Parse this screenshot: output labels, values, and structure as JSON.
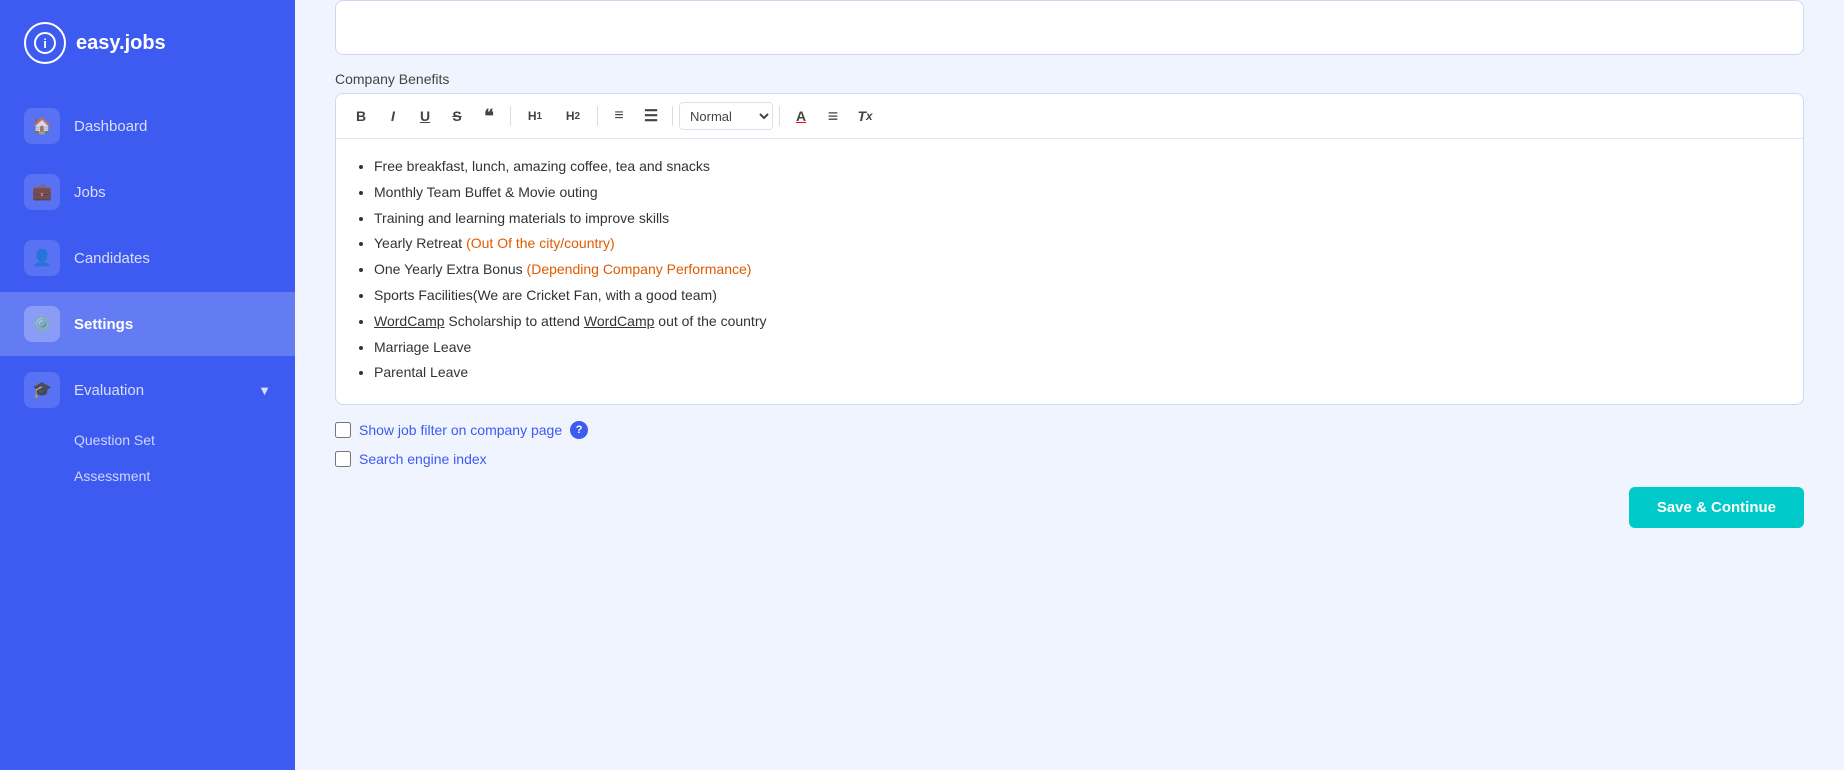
{
  "app": {
    "logo_text": "easy.jobs",
    "logo_icon": "i"
  },
  "sidebar": {
    "items": [
      {
        "id": "dashboard",
        "label": "Dashboard",
        "icon": "🏠"
      },
      {
        "id": "jobs",
        "label": "Jobs",
        "icon": "💼"
      },
      {
        "id": "candidates",
        "label": "Candidates",
        "icon": "👤"
      },
      {
        "id": "settings",
        "label": "Settings",
        "icon": "⚙️",
        "active": true
      },
      {
        "id": "evaluation",
        "label": "Evaluation",
        "icon": "🎓"
      }
    ],
    "evaluation_sub": [
      {
        "id": "question-set",
        "label": "Question Set"
      },
      {
        "id": "assessment",
        "label": "Assessment"
      }
    ]
  },
  "main": {
    "section_label": "Company Benefits",
    "toolbar": {
      "bold": "B",
      "italic": "I",
      "underline": "U",
      "strikethrough": "S",
      "quote": "❝",
      "h1": "H₁",
      "h2": "H₂",
      "ordered_list": "ol",
      "unordered_list": "ul",
      "format_select": "Normal",
      "text_color": "A",
      "align": "≡",
      "clear_format": "Tx"
    },
    "benefits": [
      "Free breakfast, lunch, amazing coffee, tea and snacks",
      "Monthly Team Buffet & Movie outing",
      "Training and learning materials to improve skills",
      "Yearly Retreat (Out Of the city/country)",
      "One Yearly Extra Bonus (Depending Company Performance)",
      "Sports Facilities(We are Cricket Fan, with a good team)",
      "WordCamp Scholarship to attend WordCamp out of the country",
      "Marriage Leave",
      "Parental Leave"
    ],
    "checkboxes": [
      {
        "id": "job-filter",
        "label": "Show job filter on company page",
        "has_help": true
      },
      {
        "id": "search-engine",
        "label": "Search engine index",
        "has_help": false
      }
    ],
    "save_button": "Save & Continue"
  }
}
